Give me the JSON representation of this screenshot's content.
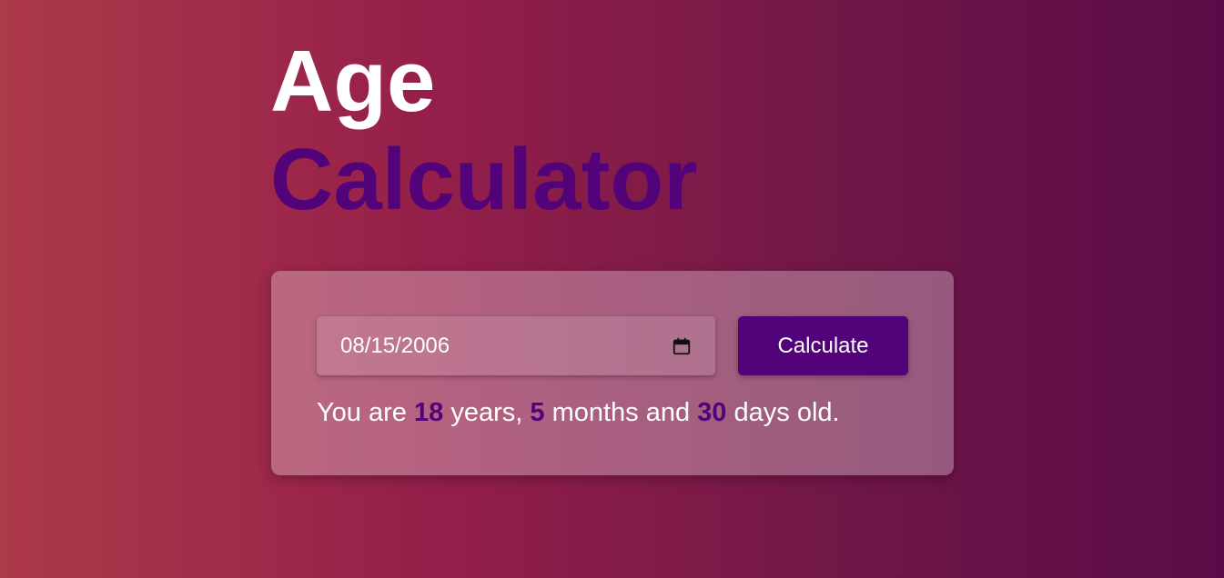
{
  "header": {
    "title_line1": "Age",
    "title_line2": "Calculator"
  },
  "form": {
    "birth_date": "08/15/2006",
    "calendar_icon": "calendar-icon",
    "calculate_label": "Calculate"
  },
  "result": {
    "prefix": "You are",
    "years": "18",
    "years_label": "years,",
    "months": "5",
    "months_label": "months and",
    "days": "30",
    "days_label": "days old."
  },
  "colors": {
    "accent": "#52037a",
    "text": "#ffffff",
    "background_start": "#ad3a49",
    "background_end": "#5a0b47"
  }
}
